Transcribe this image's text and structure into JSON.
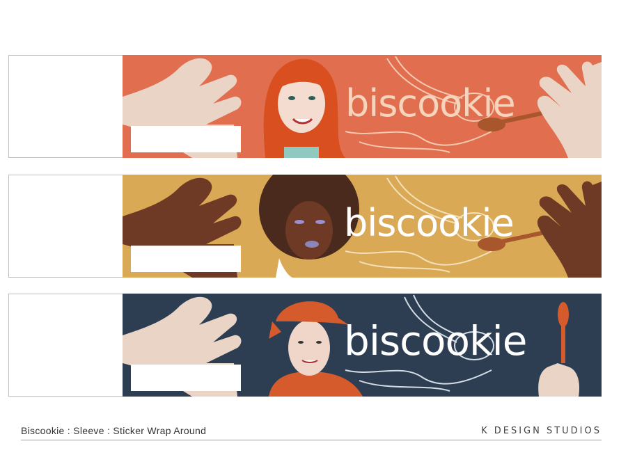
{
  "brand_name": "biscookie",
  "sleeves": [
    {
      "background": "#e06e4f",
      "brand_color": "#f6d3bb",
      "character": "red-haired-woman"
    },
    {
      "background": "#d9a956",
      "brand_color": "#ffffff",
      "character": "afro-woman"
    },
    {
      "background": "#2d3e52",
      "brand_color": "#ffffff",
      "character": "man-in-plaid-cap"
    }
  ],
  "footer": {
    "caption": "Biscookie :  Sleeve : Sticker Wrap Around",
    "studio": "K DESIGN STUDIOS"
  }
}
